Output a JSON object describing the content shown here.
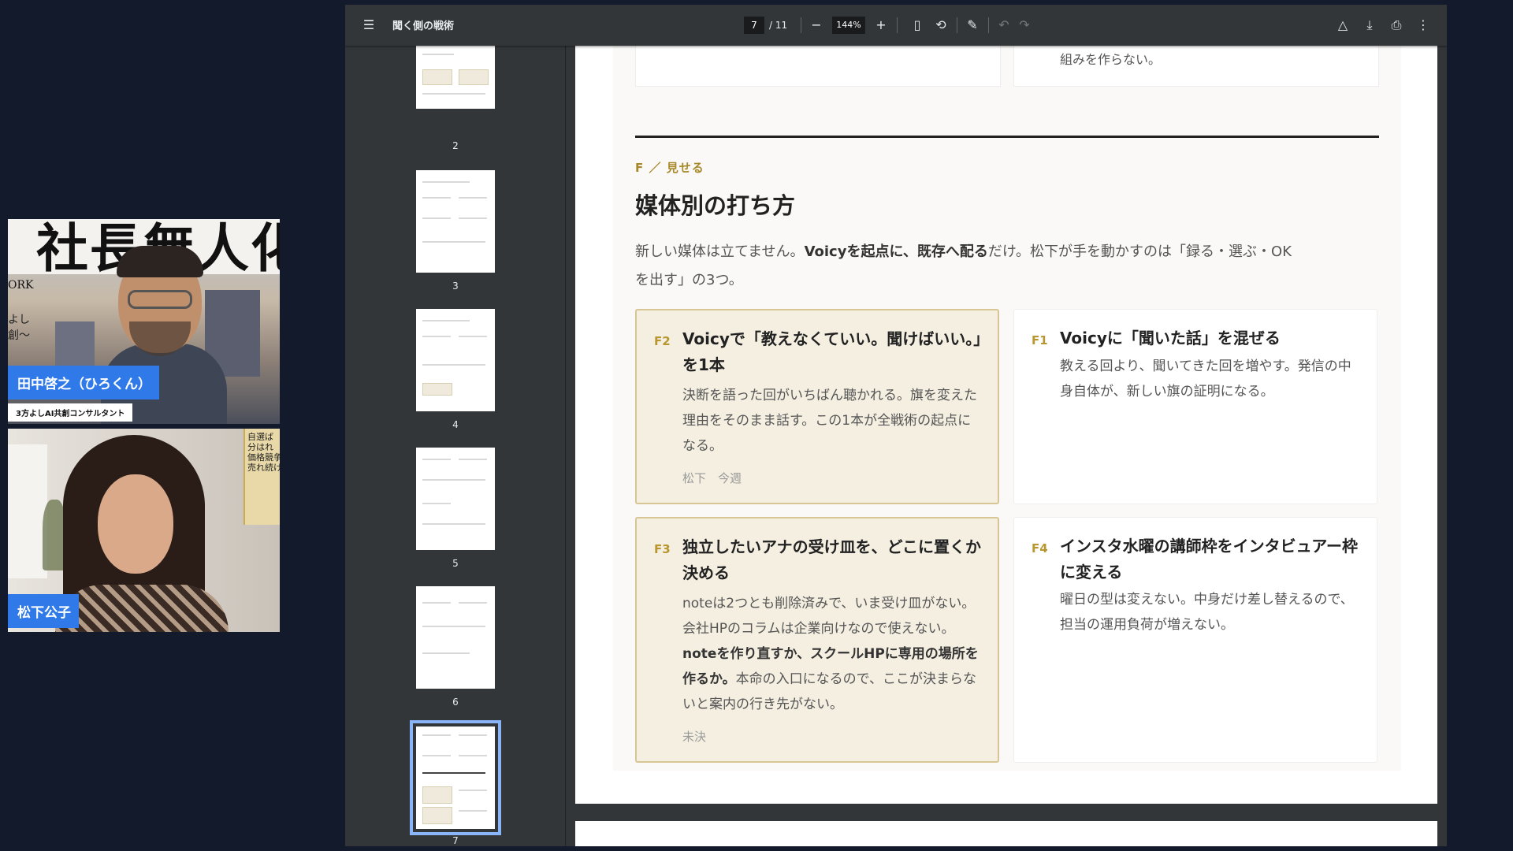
{
  "participants": [
    {
      "name": "田中啓之（ひろくん）",
      "role": "3方よしAI共創コンサルタント",
      "background_text": {
        "title": "社長無人化",
        "side1": "ORK",
        "side2": "よし\n創〜"
      }
    },
    {
      "name": "松下公子",
      "background_text": {
        "book": "自選ば\n分はれ\n価格競争をやめて\n売れ続ける力"
      }
    }
  ],
  "viewer": {
    "title": "聞く側の戦術",
    "current_page": "7",
    "page_separator": "/",
    "total_pages": "11",
    "zoom": "144%",
    "icons": [
      "menu-icon",
      "zoom-out-icon",
      "zoom-in-icon",
      "fit-page-icon",
      "rotate-icon",
      "draw-icon",
      "undo-icon",
      "redo-icon",
      "save-drive-icon",
      "download-icon",
      "print-icon",
      "more-icon"
    ]
  },
  "thumbnails": [
    "2",
    "3",
    "4",
    "5",
    "6",
    "7"
  ],
  "document": {
    "top_card_right_text": "組みを作らない。",
    "kicker": "F ／ 見せる",
    "heading": "媒体別の打ち方",
    "lead_1": "新しい媒体は立てません。",
    "lead_bold": "Voicyを起点に、既存へ配る",
    "lead_2": "だけ。松下が手を動かすのは「録る・選ぶ・OKを出す」の3つ。",
    "cards": [
      {
        "code": "F2",
        "title": "Voicyで「教えなくていい。聞けばいい。」を1本",
        "body": "決断を語った回がいちばん聴かれる。旗を変えた理由をそのまま話す。この1本が全戦術の起点になる。",
        "meta": "松下　今週"
      },
      {
        "code": "F1",
        "title": "Voicyに「聞いた話」を混ぜる",
        "body": "教える回より、聞いてきた回を増やす。発信の中身自体が、新しい旗の証明になる。"
      },
      {
        "code": "F3",
        "title": "独立したいアナの受け皿を、どこに置くか決める",
        "body_1": "noteは2つとも削除済みで、いま受け皿がない。会社HPのコラムは企業向けなので使えない。",
        "body_bold": "noteを作り直すか、スクールHPに専用の場所を作るか。",
        "body_2": "本命の入口になるので、ここが決まらないと案内の行き先がない。",
        "meta": "未決"
      },
      {
        "code": "F4",
        "title": "インスタ水曜の講師枠をインタビュアー枠に変える",
        "body": "曜日の型は変えない。中身だけ差し替えるので、担当の運用負荷が増えない。"
      }
    ]
  },
  "colors": {
    "accent_gold": "#b8972e",
    "highlight_bg": "#f4efe1",
    "name_tag_blue": "#2f79e8",
    "thumb_active": "#8ab4f8"
  }
}
